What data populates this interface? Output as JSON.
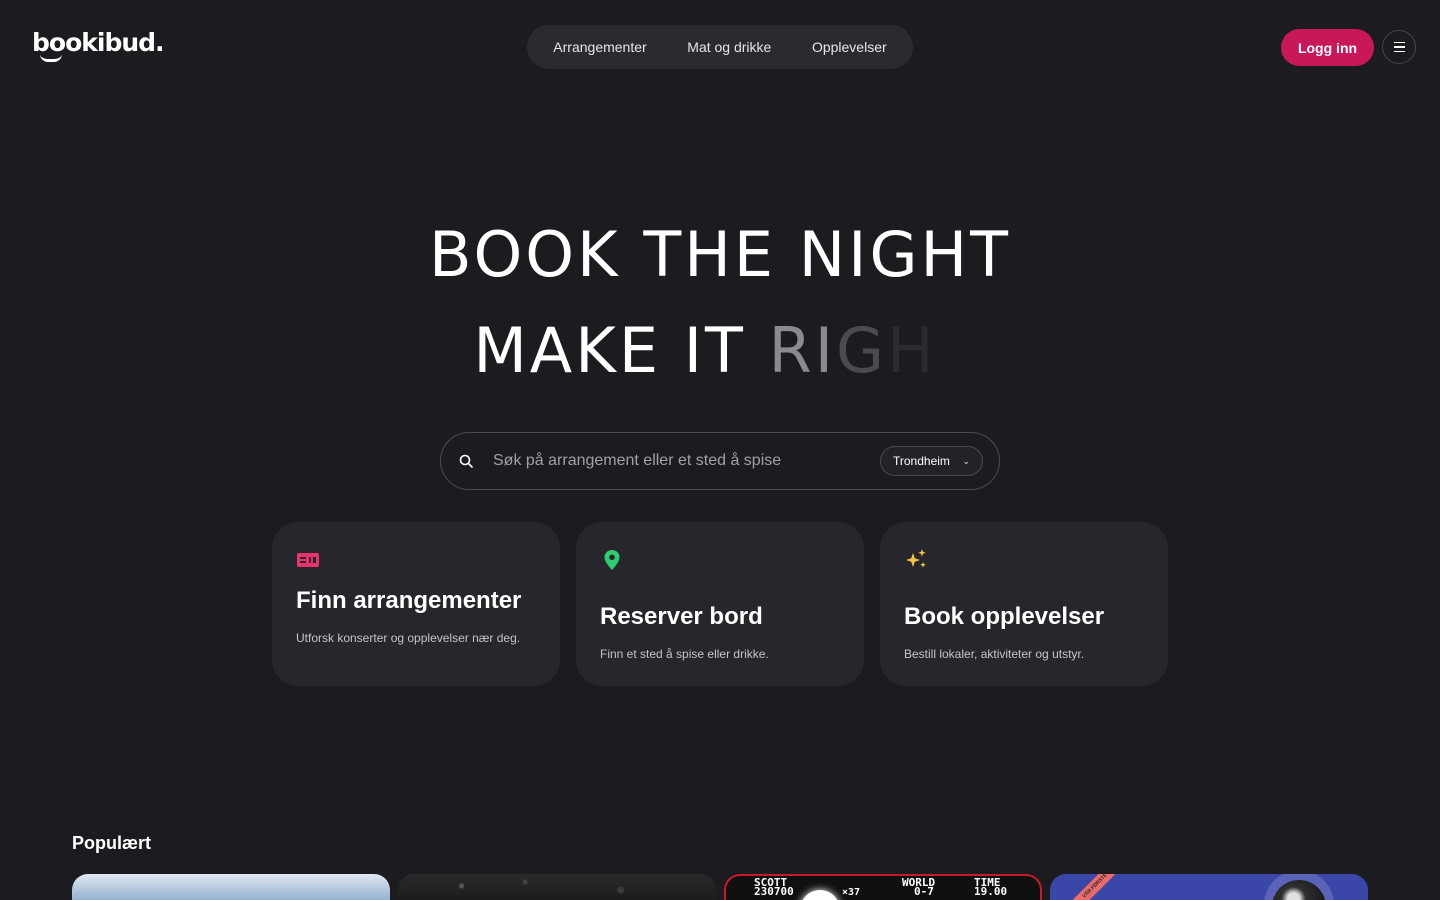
{
  "header": {
    "logo_text": "bookibud.",
    "nav": [
      "Arrangementer",
      "Mat og drikke",
      "Opplevelser"
    ],
    "login_label": "Logg inn",
    "menu_icon": "hamburger-menu-icon"
  },
  "hero": {
    "line1": "BOOK THE NIGHT",
    "line2_solid": "MAKE IT ",
    "line2_fade1": "RI",
    "line2_fade2": "G",
    "line2_fade3": "H"
  },
  "search": {
    "placeholder": "Søk på arrangement eller et sted å spise",
    "value": "",
    "city": "Trondheim"
  },
  "cards": [
    {
      "icon": "ticket-icon",
      "title": "Finn arrangementer",
      "desc": "Utforsk konserter og opplevelser nær deg.",
      "color": "#e8336d"
    },
    {
      "icon": "location-pin-icon",
      "title": "Reserver bord",
      "desc": "Finn et sted å spise eller drikke.",
      "color": "#2ecc71"
    },
    {
      "icon": "sparkles-icon",
      "title": "Book opplevelser",
      "desc": "Bestill lokaler, aktiviteter og utstyr.",
      "color": "#f5c542"
    }
  ],
  "popular": {
    "title": "Populært",
    "game_hud": {
      "player": "SCOTT",
      "score": "230700",
      "coins": "×37",
      "world_label": "WORLD",
      "world": "0-7",
      "time_label": "TIME",
      "time": "19.00"
    },
    "ribbon_text": "VÅR FØRSTE"
  },
  "colors": {
    "background": "#1b1b20",
    "accent": "#c8185a",
    "card_bg": "#26262c"
  }
}
